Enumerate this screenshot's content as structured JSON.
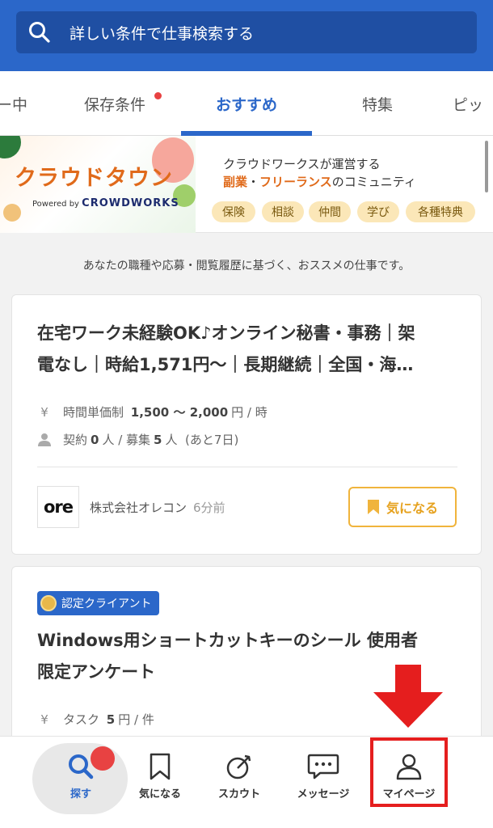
{
  "search": {
    "placeholder": "詳しい条件で仕事検索する"
  },
  "tabs": [
    {
      "label": "ー中"
    },
    {
      "label": "保存条件"
    },
    {
      "label": "おすすめ"
    },
    {
      "label": "特集"
    },
    {
      "label": "ピッ"
    }
  ],
  "banner": {
    "title": "クラウドタウン",
    "powered_by": "Powered by",
    "brand": "CROWDWORKS",
    "line1": "クラウドワークスが運営する",
    "line2_hl1": "副業",
    "line2_sep": "・",
    "line2_hl2": "フリーランス",
    "line2_rest": "のコミュニティ",
    "chips": [
      "保険",
      "相談",
      "仲間",
      "学び",
      "各種特典"
    ]
  },
  "intro": "あなたの職種や応募・閲覧履歴に基づく、おススメの仕事です。",
  "job1": {
    "title_line1": "在宅ワーク未経験OK♪オンライン秘書・事務｜架",
    "title_line2": "電なし｜時給1,571円〜｜長期継続｜全国・海…",
    "type": "時間単価制",
    "price": "1,500 〜 2,000",
    "price_unit": "円 / 時",
    "contract_label": "契約",
    "contract_count": "0",
    "contract_unit": "人 / 募集",
    "recruit_count": "5",
    "recruit_unit": "人",
    "deadline": "(あと7日)",
    "logo_text": "ore",
    "company": "株式会社オレコン",
    "posted": "6分前",
    "fav_label": "気になる"
  },
  "job2": {
    "badge": "認定クライアント",
    "title_line1": "Windows用ショートカットキーのシール 使用者",
    "title_line2": "限定アンケート",
    "type": "タスク",
    "price": "5",
    "price_unit": "円 / 件"
  },
  "nav": [
    {
      "label": "探す"
    },
    {
      "label": "気になる"
    },
    {
      "label": "スカウト"
    },
    {
      "label": "メッセージ"
    },
    {
      "label": "マイページ"
    }
  ],
  "colors": {
    "brand_blue": "#2b67c9",
    "accent_orange": "#e06a1a",
    "alert_red": "#e51e1e"
  }
}
